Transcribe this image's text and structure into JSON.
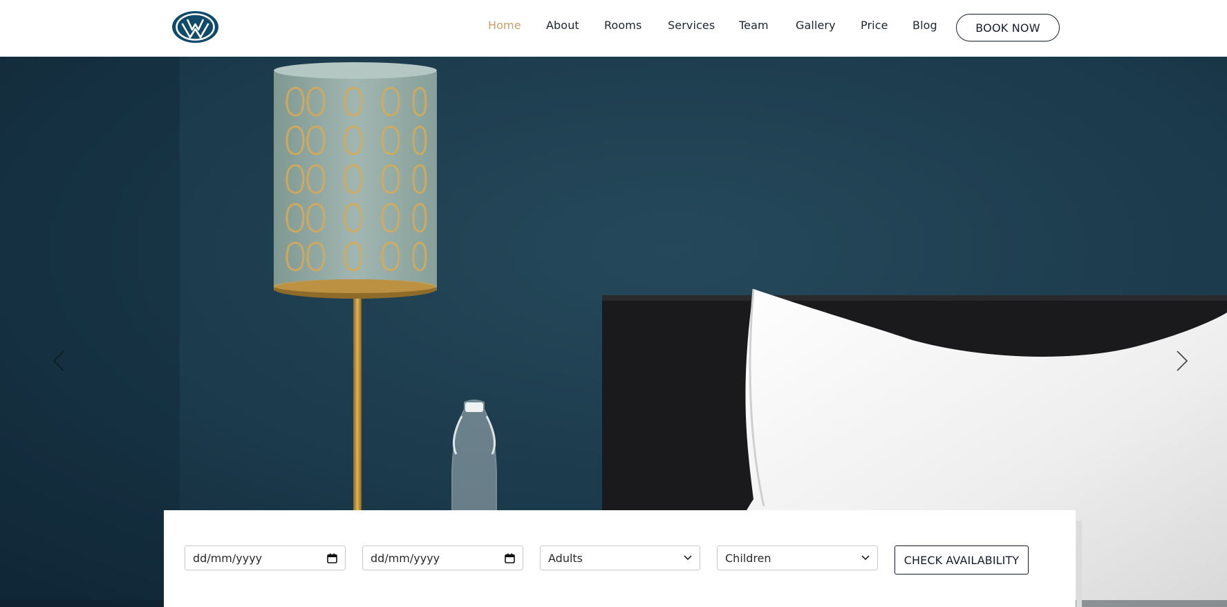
{
  "header": {
    "logo_icon": "vw-logo-icon",
    "nav": [
      {
        "label": "Home",
        "active": true
      },
      {
        "label": "About"
      },
      {
        "label": "Rooms"
      },
      {
        "label": "Services"
      },
      {
        "label": "Team"
      },
      {
        "label": "Gallery"
      },
      {
        "label": "Price"
      },
      {
        "label": "Blog"
      }
    ],
    "book_label": "BOOK NOW"
  },
  "hero": {
    "prev_icon": "chevron-left-icon",
    "next_icon": "chevron-right-icon"
  },
  "booking": {
    "checkin_placeholder": "dd/mm/yyyy",
    "checkout_placeholder": "dd/mm/yyyy",
    "adults_value": "Adults",
    "children_value": "Children",
    "check_label": "CHECK AVAILABILITY"
  },
  "colors": {
    "accent": "#c9a063",
    "dark": "#141b2b",
    "logo": "#0f4a6b",
    "wall": "#1c3c4d"
  }
}
